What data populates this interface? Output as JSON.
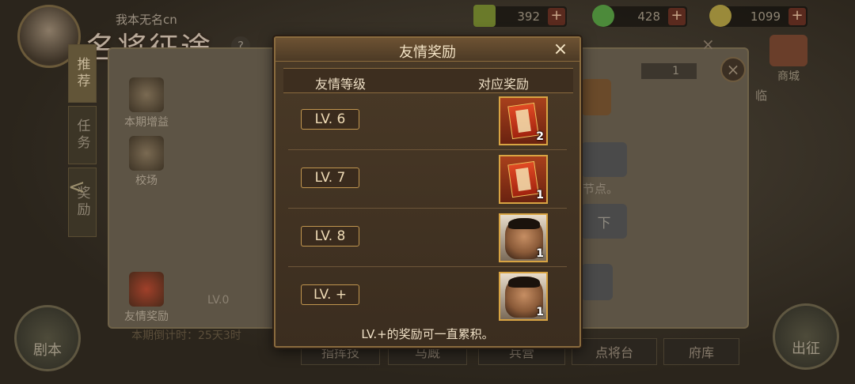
{
  "background": {
    "player_name": "我本无名cn",
    "logo": "名将征途",
    "help": "?",
    "resources": [
      {
        "value": "392",
        "icon": "bamboo-scroll-icon",
        "plus": "+"
      },
      {
        "value": "428",
        "icon": "green-jade-icon",
        "plus": "+"
      },
      {
        "value": "1099",
        "icon": "gold-ingot-icon",
        "plus": "+"
      }
    ],
    "left_tabs": [
      "推荐",
      "任务",
      "奖励"
    ],
    "left_arrow": "<",
    "side_items": [
      "本期增益",
      "校场",
      "友情奖励"
    ],
    "shop": "商城",
    "bowl_count": "1",
    "hint_text": "节点。",
    "hint_text2": "临",
    "button_down": "下",
    "lv_strip": "LV.0",
    "countdown": "本期倒计时：25天3时",
    "bottom_left": "剧本",
    "bottom_right": "出征",
    "bottom_menu": [
      "指挥技",
      "马厩",
      "兵营",
      "点将台",
      "府库"
    ],
    "close": "×"
  },
  "modal": {
    "title": "友情奖励",
    "close_icon": "×",
    "col_level": "友情等级",
    "col_reward": "对应奖励",
    "rows": [
      {
        "level": "LV. 6",
        "reward": "token",
        "count": "2"
      },
      {
        "level": "LV. 7",
        "reward": "token",
        "count": "1"
      },
      {
        "level": "LV. 8",
        "reward": "hero",
        "count": "1"
      },
      {
        "level": "LV. +",
        "reward": "hero",
        "count": "1"
      }
    ],
    "footer": "LV.+的奖励可一直累积。"
  }
}
